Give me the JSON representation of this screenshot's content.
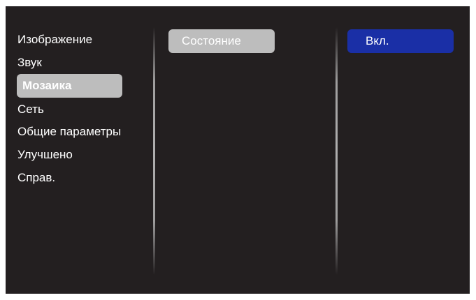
{
  "menu": {
    "items": [
      {
        "label": "Изображение"
      },
      {
        "label": "Звук"
      },
      {
        "label": "Мозаика",
        "selected": true
      },
      {
        "label": "Сеть"
      },
      {
        "label": "Общие параметры"
      },
      {
        "label": "Улучшено"
      },
      {
        "label": "Справ."
      }
    ]
  },
  "submenu": {
    "status_label": "Состояние"
  },
  "values": {
    "selected_value": "Вкл."
  },
  "colors": {
    "background": "#231f20",
    "highlight_gray": "#bdbdbd",
    "highlight_blue": "#1a2fa6",
    "text": "#ffffff"
  }
}
